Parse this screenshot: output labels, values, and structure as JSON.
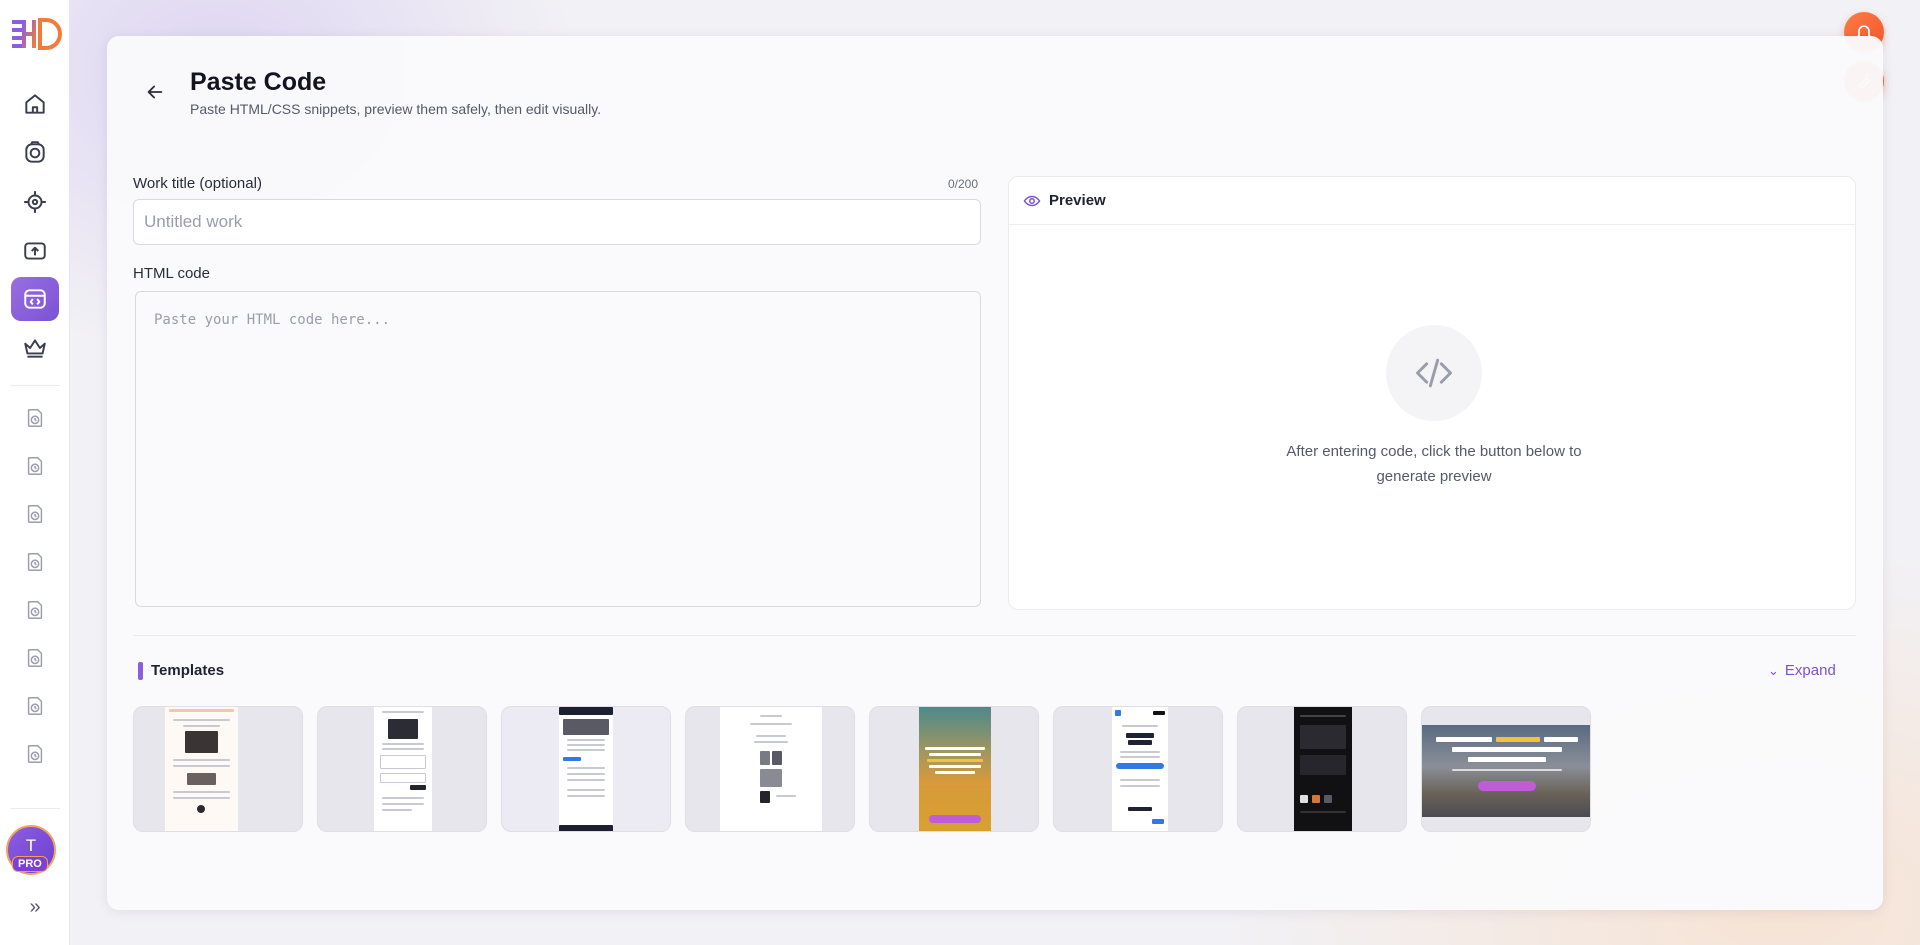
{
  "header": {
    "title": "Paste Code",
    "subtitle": "Paste HTML/CSS snippets, preview them safely, then edit visually."
  },
  "form": {
    "title_label": "Work title (optional)",
    "title_counter": "0/200",
    "title_placeholder": "Untitled work",
    "title_value": "",
    "code_label": "HTML code",
    "code_placeholder": "Paste your HTML code here...",
    "code_value": ""
  },
  "preview": {
    "title": "Preview",
    "hint": "After entering code, click the button below to generate preview"
  },
  "templates": {
    "title": "Templates",
    "expand_label": "Expand",
    "items": [
      {
        "name": "template-1",
        "accent": "#2b2a30"
      },
      {
        "name": "template-2",
        "accent": "#23242c"
      },
      {
        "name": "template-3",
        "accent": "#1d2030"
      },
      {
        "name": "template-4",
        "accent": "#23242c"
      },
      {
        "name": "template-5",
        "accent": "#e5a431"
      },
      {
        "name": "template-6",
        "accent": "#2f7ae5"
      },
      {
        "name": "template-7",
        "accent": "#111114"
      },
      {
        "name": "template-8",
        "accent": "#d8a92f"
      }
    ]
  },
  "sidebar": {
    "nav_icons": [
      "home-icon",
      "camera-icon",
      "target-icon",
      "upload-icon",
      "code-icon",
      "crown-icon"
    ],
    "history_icons": [
      "history-icon",
      "history-icon",
      "history-icon",
      "history-icon",
      "history-icon",
      "history-icon",
      "history-icon",
      "history-icon"
    ],
    "avatar_initial": "T",
    "pro_badge": "PRO"
  },
  "colors": {
    "accent": "#7b52d6",
    "orange": "#f0572d"
  }
}
